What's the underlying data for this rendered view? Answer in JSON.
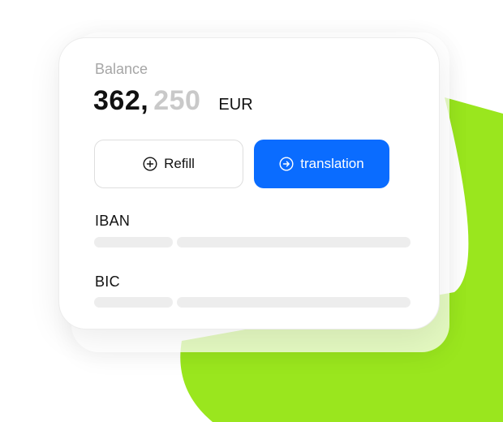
{
  "balance": {
    "label": "Balance",
    "amount_main": "362,",
    "amount_cents": "250",
    "currency": "EUR"
  },
  "actions": {
    "refill_label": "Refill",
    "refill_icon": "plus-circle-icon",
    "translation_label": "translation",
    "translation_icon": "arrow-right-circle-icon"
  },
  "fields": {
    "iban_label": "IBAN",
    "bic_label": "BIC"
  },
  "colors": {
    "accent_blue": "#0a6cff",
    "accent_green": "#9ae61e",
    "muted_text": "#a6a6a6",
    "placeholder": "#ededed"
  }
}
